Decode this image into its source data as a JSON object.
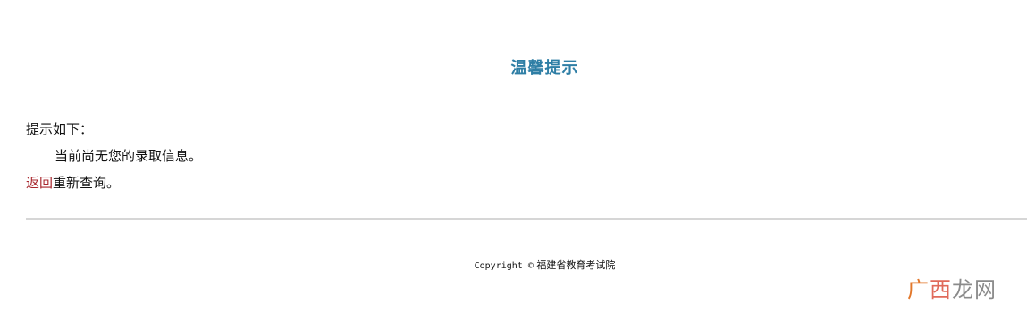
{
  "header": {
    "title": "温馨提示"
  },
  "message": {
    "heading": "提示如下：",
    "body": "当前尚无您的录取信息。",
    "back_link": "返回",
    "back_suffix": "重新查询。"
  },
  "footer": {
    "copyright_label": "Copyright ©",
    "org_name": "福建省教育考试院"
  },
  "watermark": {
    "char1": "广",
    "char2": "西",
    "char3": "龙网"
  },
  "colors": {
    "title": "#2e7ea5",
    "link": "#a8272d",
    "divider": "#d6d6d6"
  }
}
